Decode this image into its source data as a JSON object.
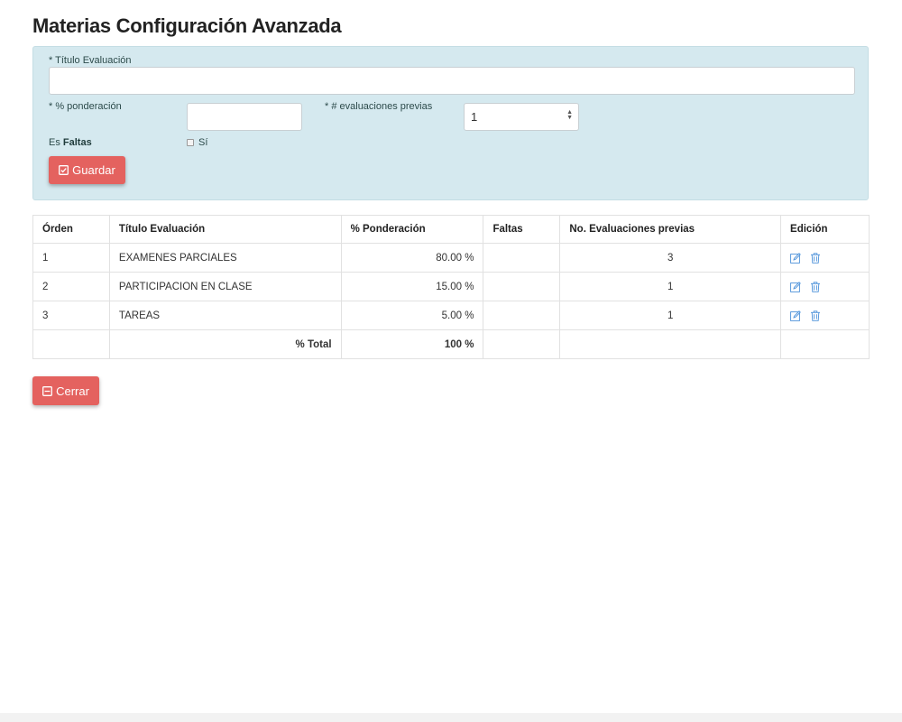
{
  "page": {
    "title": "Materias Configuración Avanzada"
  },
  "form": {
    "titulo_label": "* Título Evaluación",
    "titulo_value": "",
    "ponderacion_label": "* % ponderación",
    "ponderacion_value": "",
    "evaluaciones_label": "* # evaluaciones previas",
    "evaluaciones_selected": "1",
    "faltas_prefix": "Es",
    "faltas_bold": "Faltas",
    "faltas_option": "Sí",
    "faltas_checked": false,
    "save_label": "Guardar"
  },
  "table": {
    "headers": [
      "Órden",
      "Título Evaluación",
      "% Ponderación",
      "Faltas",
      "No. Evaluaciones previas",
      "Edición"
    ],
    "rows": [
      {
        "orden": "1",
        "titulo": "EXAMENES PARCIALES",
        "ponderacion": "80.00 %",
        "faltas": "",
        "previas": "3"
      },
      {
        "orden": "2",
        "titulo": "PARTICIPACION EN CLASE",
        "ponderacion": "15.00 %",
        "faltas": "",
        "previas": "1"
      },
      {
        "orden": "3",
        "titulo": "TAREAS",
        "ponderacion": "5.00 %",
        "faltas": "",
        "previas": "1"
      }
    ],
    "total_label": "% Total",
    "total_value": "100 %"
  },
  "actions": {
    "close_label": "Cerrar"
  },
  "colors": {
    "accent_button": "#e4625f",
    "panel_bg": "#d5e9ef",
    "icon_blue": "#4a90d9"
  },
  "icons": {
    "edit": "edit-icon",
    "delete": "trash-icon",
    "save": "checkbox-check-icon",
    "close": "minus-square-icon"
  }
}
